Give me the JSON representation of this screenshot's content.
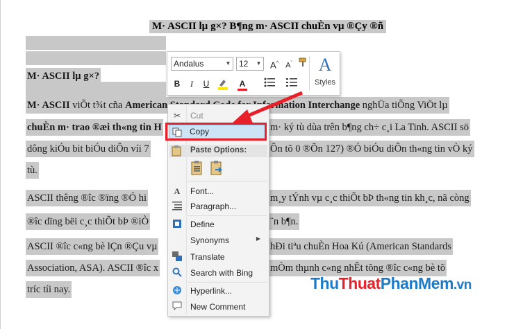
{
  "document": {
    "title": "M· ASCII lµ g×? B¶ng m· ASCII chuÈn vµ ®Çy ®ñ",
    "heading": "M· ASCII lµ g×?",
    "p1_bold": "M· ASCII",
    "p1_text1": " viÕt t¾t cña ",
    "p1_bold2": "American Standard Code for Information Interchange",
    "p1_text2": " nghÜa tiÕng ViÖt lµ",
    "p2_bold": "chuÈn m· trao ®æi th«ng tin H",
    "p2_text": "m· ký tù dùa trên b¶ng ch÷ c¸i La Tinh. ASCII sö",
    "p3_text_a": "dông kiÓu bit biÓu diÔn víi 7",
    "p3_text_b": "Ôn tõ 0 ®Õn 127) ®Ó biÓu diÔn th«ng tin vÒ ký",
    "p4_text": "tù.",
    "p5_text_a": "ASCII th­êng ®­îc ®ïng ®Ó hi",
    "p5_text_b": "m¸y tÝnh vµ c¸c thiÕt bÞ th«ng tin kh¸c, nã còng",
    "p6_text_a": "®­îc dïng bëi c¸c thiÕt bÞ ®iÒ",
    "p6_text_b": "¨n b¶n.",
    "p7_text_a": "ASCII ®­îc c«ng bè lÇn ®Çu vµ",
    "p7_text_b": "hÐi tiªu chuÈn Hoa Kú (American Standards",
    "p8_text_a": "Association, ASA). ASCII ®­îc x",
    "p8_text_b": "mÒm thµnh c«ng nhÊt tõng ®­îc c«ng bè tõ",
    "p9_text": "tr­íc tíi nay."
  },
  "minibar": {
    "font_name": "Andalus",
    "font_size": "12",
    "styles_label": "Styles",
    "bold": "B",
    "italic": "I",
    "underline": "U",
    "font_color": "A"
  },
  "context_menu": {
    "cut": "Cut",
    "copy": "Copy",
    "paste_options": "Paste Options:",
    "font": "Font...",
    "paragraph": "Paragraph...",
    "define": "Define",
    "synonyms": "Synonyms",
    "translate": "Translate",
    "search_bing": "Search with Bing",
    "hyperlink": "Hyperlink...",
    "new_comment": "New Comment"
  },
  "watermark": {
    "part1": "Thu",
    "part2": "Thuat",
    "part3": "PhanMem",
    "part4": ".vn"
  },
  "colors": {
    "selection": "#c8c8c8",
    "highlight_border": "#e8202a",
    "accent_blue": "#1d7bc7",
    "watermark_red": "#e8222a"
  }
}
